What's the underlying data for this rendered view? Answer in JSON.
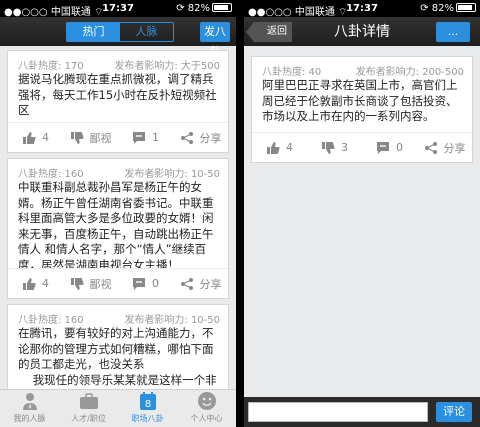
{
  "status": {
    "carrier": "中国联通",
    "time": "17:37",
    "battery": "82%"
  },
  "left": {
    "segments": [
      "热门",
      "人脉"
    ],
    "post_button": "发八卦",
    "posts": [
      {
        "heat": "八卦热度: 170",
        "influence": "发布者影响力: 大于500",
        "text": "据说马化腾现在重点抓微视，调了精兵强将，每天工作15小时在反扑短视频社区",
        "likes": "4",
        "dislike_label": "鄙视",
        "comments": "1",
        "share_label": "分享"
      },
      {
        "heat": "八卦热度: 160",
        "influence": "发布者影响力: 10-50",
        "text": "中联重科副总裁孙昌军是杨正午的女婿。杨正午曾任湖南省委书记。中联重科里面高管大多是多位政要的女婿！闲来无事，百度杨正午，自动跳出杨正午 情人 和情人名字，那个“情人”继续百度，居然是湖南电视台女主播！",
        "likes": "4",
        "dislike_label": "鄙视",
        "comments": "0",
        "share_label": "分享"
      },
      {
        "heat": "八卦热度: 160",
        "influence": "发布者影响力: 10-50",
        "text": "在腾讯，要有较好的对上沟通能力，不论那你的管理方式如何糟糕，哪怕下面的员工都走光，也没关系\n    我现任的领导乐某某就是这样一个非常成功的人。她一年多前从业务部门转来",
        "likes": "",
        "dislike_label": "",
        "comments": "",
        "share_label": ""
      }
    ],
    "tabs": [
      {
        "label": "我的人脉",
        "icon": "person-icon"
      },
      {
        "label": "人才/职位",
        "icon": "briefcase-icon"
      },
      {
        "label": "职场八卦",
        "icon": "calendar-icon"
      },
      {
        "label": "个人中心",
        "icon": "smiley-icon"
      }
    ],
    "active_tab_day": "8"
  },
  "right": {
    "back_label": "返回",
    "title": "八卦详情",
    "more_label": "...",
    "post": {
      "heat": "八卦热度: 40",
      "influence": "发布者影响力: 200-500",
      "text": "阿里巴巴正寻求在英国上市，高官们上周已经于伦敦副市长商谈了包括投资、市场以及上市在内的一系列内容。",
      "likes": "4",
      "dislikes": "3",
      "comments": "0",
      "share_label": "分享"
    },
    "comment_placeholder": "",
    "comment_button": "评论"
  },
  "colors": {
    "accent": "#2b8fe0",
    "background": "#e9eaec"
  }
}
